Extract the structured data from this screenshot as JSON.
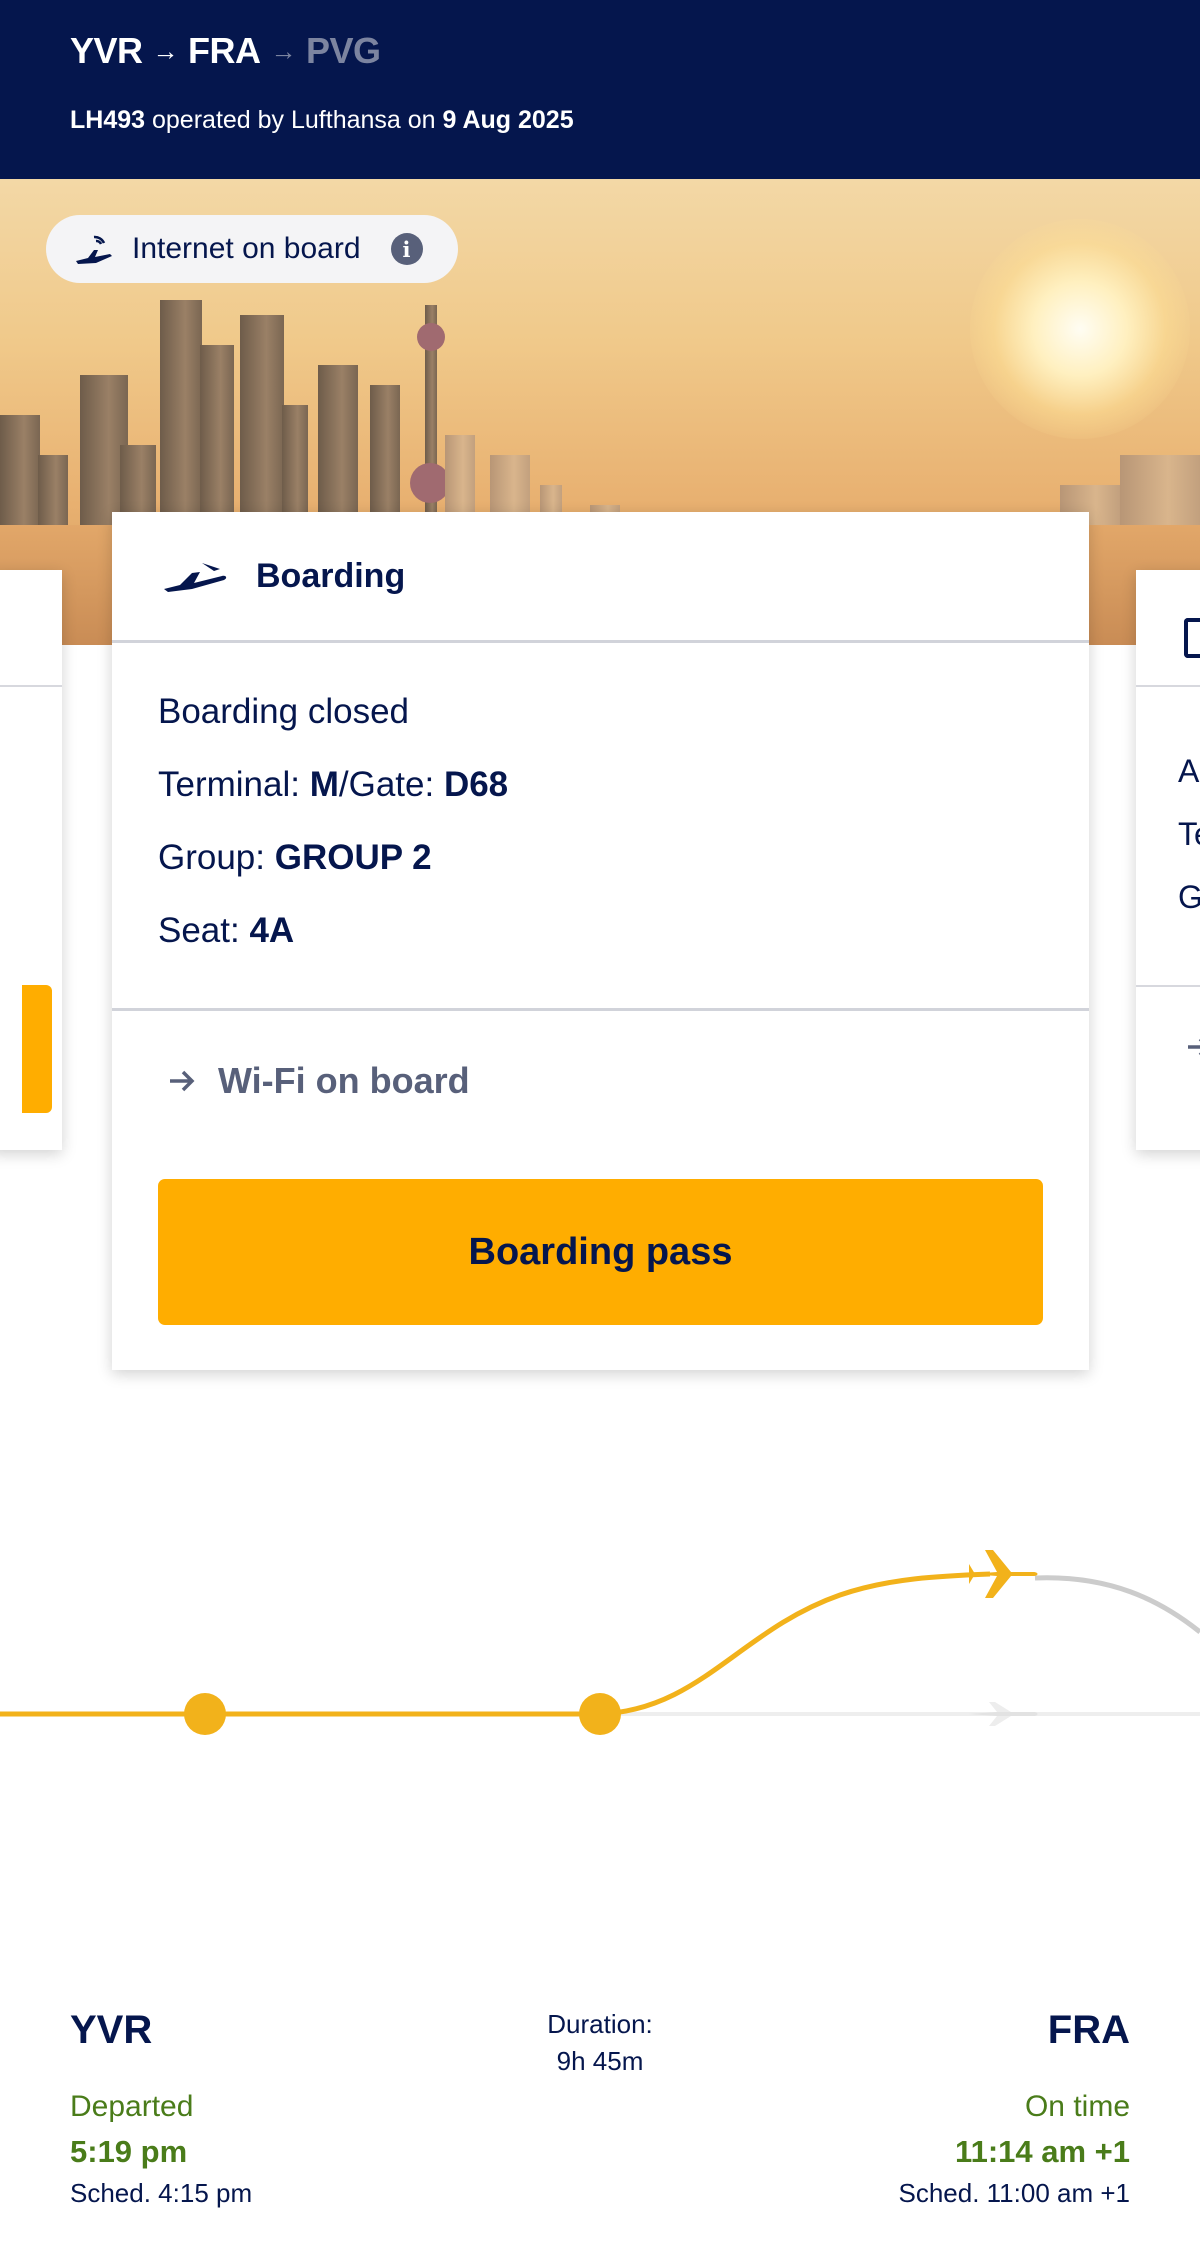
{
  "header": {
    "origin": "YVR",
    "connection": "FRA",
    "destination": "PVG",
    "flight_number": "LH493",
    "operated_text": "operated by Lufthansa on",
    "date": "9 Aug 2025"
  },
  "hero": {
    "wifi_pill_label": "Internet on board"
  },
  "boarding_card": {
    "title": "Boarding",
    "status": "Boarding closed",
    "terminal_label": "Terminal:",
    "terminal": "M",
    "gate_label": "/Gate:",
    "gate": "D68",
    "group_label": "Group:",
    "group": "GROUP 2",
    "seat_label": "Seat:",
    "seat": "4A",
    "wifi_link": "Wi-Fi on board",
    "boarding_pass_button": "Boarding pass"
  },
  "right_card_fragments": [
    "A",
    "Te",
    "G"
  ],
  "flight": {
    "departure_code": "YVR",
    "arrival_code": "FRA",
    "duration_label": "Duration:",
    "duration": "9h 45m",
    "departure_status": "Departed",
    "departure_time": "5:19 pm",
    "departure_sched": "Sched. 4:15 pm",
    "arrival_status": "On time",
    "arrival_time": "11:14 am +1",
    "arrival_sched": "Sched. 11:00 am +1",
    "progress_fraction": 0.62
  },
  "colors": {
    "navy": "#05164d",
    "yellow": "#ffad00",
    "green": "#4a7c1a",
    "grey": "#58607a"
  }
}
